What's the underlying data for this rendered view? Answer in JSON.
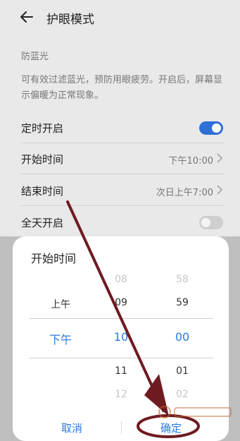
{
  "header": {
    "title": "护眼模式"
  },
  "section": {
    "label": "防蓝光"
  },
  "description": "可有效过滤蓝光，预防用眼疲劳。开启后，屏幕显示偏暖为正常现象。",
  "rows": [
    {
      "label": "定时开启",
      "toggle": "on"
    },
    {
      "label": "开始时间",
      "value": "下午10:00"
    },
    {
      "label": "结束时间",
      "value": "次日上午7:00"
    },
    {
      "label": "全天开启",
      "toggle": "off"
    }
  ],
  "dialog": {
    "title": "开始时间",
    "ampm": {
      "above": "上午",
      "selected": "下午"
    },
    "hours": {
      "above2": "08",
      "above1": "09",
      "selected": "10",
      "below1": "11",
      "below2": "12"
    },
    "minutes": {
      "above2": "58",
      "above1": "59",
      "selected": "00",
      "below1": "01",
      "below2": "02"
    },
    "cancel_label": "取消",
    "confirm_label": "确定"
  },
  "colors": {
    "accent": "#2a7be4",
    "toggle_on": "#2f6fd6",
    "annotation": "#7a1a22"
  }
}
